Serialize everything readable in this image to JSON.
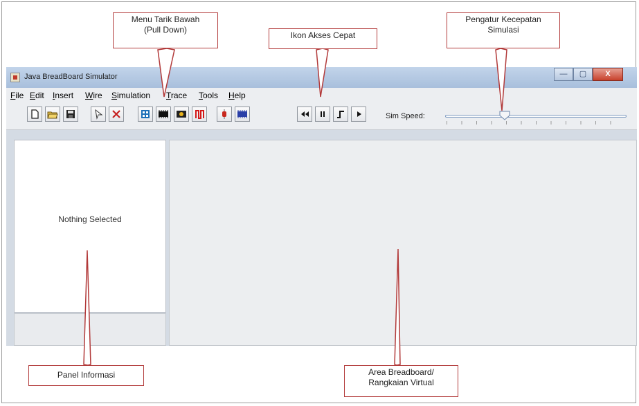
{
  "window": {
    "title": "Java BreadBoard Simulator",
    "controls": {
      "minimize": "—",
      "maximize": "▢",
      "close": "X"
    }
  },
  "menubar": {
    "items": [
      {
        "label": "File",
        "mnemonic": "F",
        "rest": "ile"
      },
      {
        "label": "Edit",
        "mnemonic": "E",
        "rest": "dit"
      },
      {
        "label": "Insert",
        "mnemonic": "I",
        "rest": "nsert"
      },
      {
        "label": "Wire",
        "mnemonic": "W",
        "rest": "ire"
      },
      {
        "label": "Simulation",
        "mnemonic": "S",
        "rest": "imulation"
      },
      {
        "label": "Trace",
        "mnemonic": "T",
        "rest": "race"
      },
      {
        "label": "Tools",
        "mnemonic": "T",
        "rest": "ools"
      },
      {
        "label": "Help",
        "mnemonic": "H",
        "rest": "elp"
      }
    ]
  },
  "toolbar": {
    "buttons": [
      "new-file-icon",
      "open-folder-icon",
      "save-icon",
      "select-pointer-icon",
      "delete-icon",
      "chip-blue-icon",
      "chip-black-icon",
      "chip-yellow-icon",
      "wire-red-icon",
      "component-red-icon",
      "chip-blue2-icon",
      "rewind-icon",
      "pause-icon",
      "step-icon",
      "play-icon"
    ],
    "sim_speed_label": "Sim Speed:",
    "sim_speed_value": 0.35
  },
  "info_panel": {
    "text": "Nothing Selected"
  },
  "annotations": {
    "menu": "Menu Tarik Bawah\n(Pull Down)",
    "quick_icons": "Ikon Akses Cepat",
    "speed": "Pengatur Kecepatan\nSimulasi",
    "info_panel": "Panel Informasi",
    "breadboard": "Area Breadboard/\nRangkaian Virtual"
  },
  "colors": {
    "callout_border": "#b23a3a",
    "titlebar": "#b4c8e2",
    "close_button": "#c7412c"
  }
}
